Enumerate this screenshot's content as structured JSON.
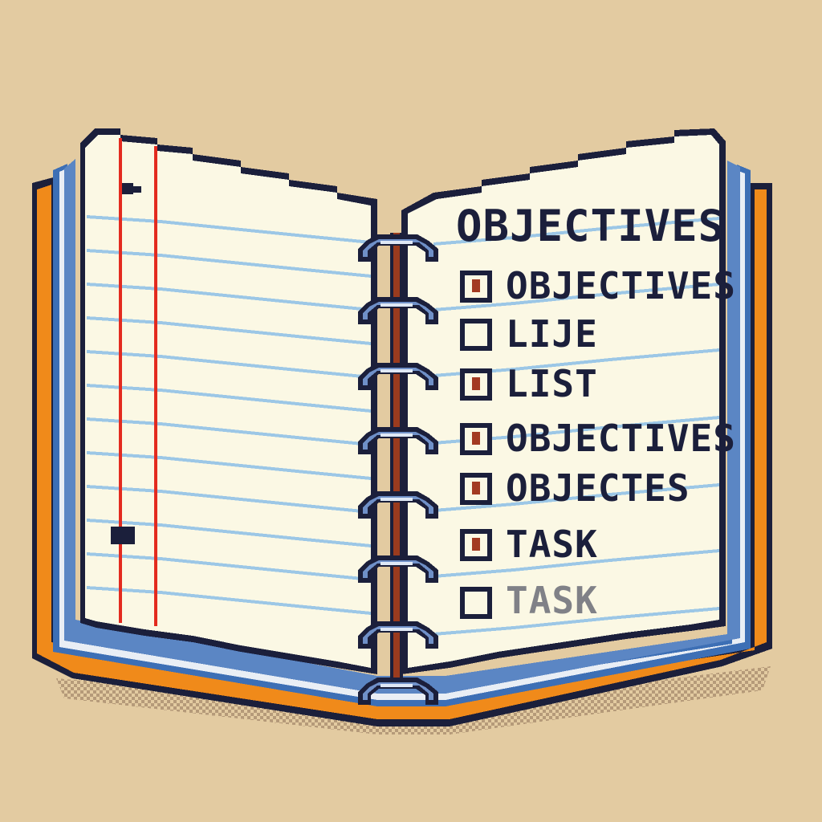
{
  "objectives": {
    "title": "OBJECTIVES",
    "items": [
      {
        "label": "OBJECTIVES",
        "checked": true
      },
      {
        "label": "LIJE",
        "checked": false
      },
      {
        "label": "LIST",
        "checked": true
      },
      {
        "label": "OBJECTIVES",
        "checked": true
      },
      {
        "label": "OBJECTES",
        "checked": true
      },
      {
        "label": "TASK",
        "checked": true
      },
      {
        "label": "TASK",
        "checked": false,
        "faded": true
      }
    ]
  },
  "colors": {
    "background": "#e3cba1",
    "paper": "#fbf8e4",
    "ruled_line": "#9cc7e6",
    "margin_line": "#e32b1f",
    "cover": "#f08a1a",
    "page_edges": "#3d6fb5",
    "ring": "#6f90c8",
    "spine": "#9a3b1e",
    "ink": "#1b1f3b"
  },
  "icons": [
    "spiral-ring-icon",
    "checkbox-icon",
    "checkmark-icon"
  ]
}
